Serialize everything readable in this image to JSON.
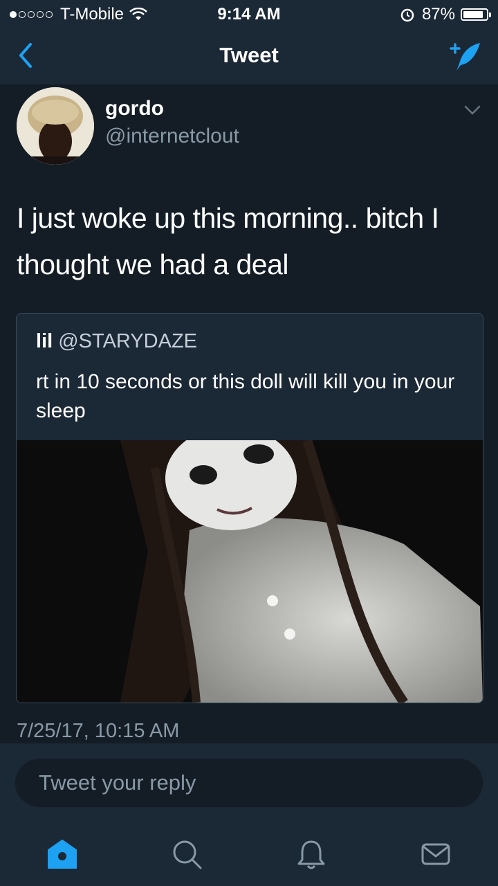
{
  "status_bar": {
    "carrier": "T-Mobile",
    "signal_bars": 1,
    "time": "9:14 AM",
    "battery": "87%",
    "battery_level": 0.87
  },
  "nav": {
    "title": "Tweet",
    "back_icon": "chevron-left-icon",
    "compose_icon": "compose-tweet-icon"
  },
  "tweet": {
    "author_name": "gordo",
    "author_handle": "@internetclout",
    "text": "I just woke up this morning.. bitch I thought we had a deal",
    "timestamp": "7/25/17, 10:15 AM",
    "quoted": {
      "author_name": "lil",
      "author_handle": "@STARYDAZE",
      "text": "rt in 10 seconds or this doll will kill you in your sleep"
    }
  },
  "reply": {
    "placeholder": "Tweet your reply"
  },
  "tabs": [
    {
      "icon": "home-icon",
      "active": true
    },
    {
      "icon": "search-icon",
      "active": false
    },
    {
      "icon": "notifications-bell-icon",
      "active": false
    },
    {
      "icon": "messages-envelope-icon",
      "active": false
    }
  ],
  "colors": {
    "background": "#141d26",
    "bars": "#1b2836",
    "accent": "#1da1f2",
    "secondary_text": "#8899a6"
  }
}
